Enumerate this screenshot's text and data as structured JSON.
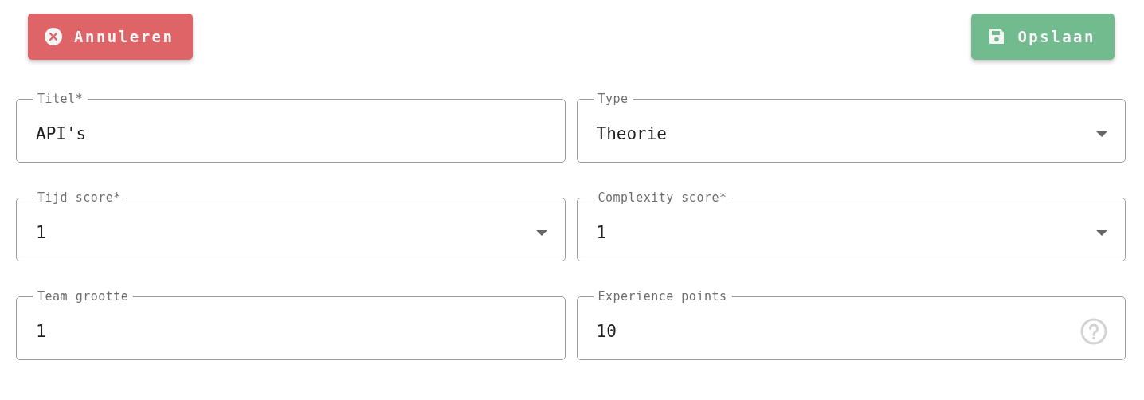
{
  "actions": [
    {
      "kind": "cancel",
      "label": "Annuleren"
    },
    {
      "kind": "save",
      "label": "Opslaan"
    }
  ],
  "fields": [
    {
      "kind": "text",
      "label": "Titel*",
      "value": "API's"
    },
    {
      "kind": "select",
      "label": "Type",
      "value": "Theorie"
    },
    {
      "kind": "select",
      "label": "Tijd score*",
      "value": "1"
    },
    {
      "kind": "select",
      "label": "Complexity score*",
      "value": "1"
    },
    {
      "kind": "text",
      "label": "Team grootte",
      "value": "1"
    },
    {
      "kind": "help",
      "label": "Experience points",
      "value": "10"
    }
  ]
}
